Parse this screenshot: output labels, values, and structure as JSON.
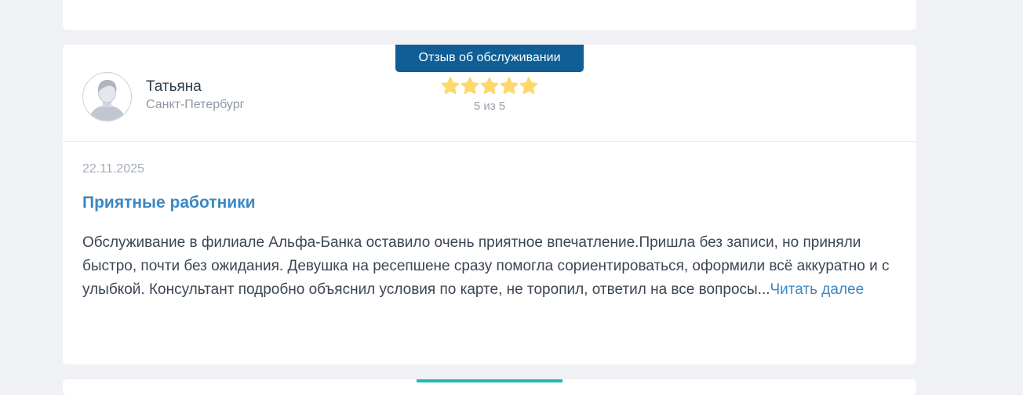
{
  "review": {
    "badge": "Отзыв об обслуживании",
    "user_name": "Татьяна",
    "user_city": "Санкт-Петербург",
    "rating": 5,
    "rating_text": "5 из 5",
    "date": "22.11.2025",
    "title": "Приятные работники",
    "text": "Обслуживание в филиале Альфа-Банка оставило очень приятное впечатление.Пришла без записи, но приняли быстро, почти без ожидания. Девушка на ресепшене сразу помогла сориентироваться, оформили всё аккуратно и с улыбкой. Консультант подробно объяснил условия по карте, не торопил, ответил на все вопросы...",
    "read_more": "Читать далее"
  },
  "colors": {
    "badge": "#0f5e95",
    "link": "#3b88c3",
    "star": "#fdd86b",
    "tab_accent": "#1fb8b4"
  },
  "icons": {
    "avatar": "user-silhouette-icon",
    "star": "star-icon"
  }
}
